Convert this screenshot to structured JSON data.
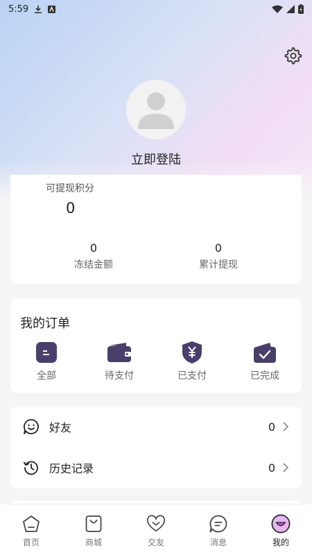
{
  "status_bar": {
    "time": "5:59"
  },
  "profile": {
    "login_label": "立即登陆"
  },
  "points": {
    "withdrawable_label": "可提现积分",
    "withdrawable_value": "0",
    "frozen_value": "0",
    "frozen_label": "冻结金额",
    "total_withdrawn_value": "0",
    "total_withdrawn_label": "累计提现"
  },
  "orders": {
    "title": "我的订单",
    "items": [
      {
        "label": "全部",
        "icon": "all-orders-icon"
      },
      {
        "label": "待支付",
        "icon": "wallet-icon"
      },
      {
        "label": "已支付",
        "icon": "yen-shield-icon"
      },
      {
        "label": "已完成",
        "icon": "check-wallet-icon"
      }
    ]
  },
  "list": [
    {
      "label": "好友",
      "count": "0",
      "icon": "smile-chat-icon"
    },
    {
      "label": "历史记录",
      "count": "0",
      "icon": "history-icon"
    }
  ],
  "tabs": [
    {
      "label": "首页",
      "icon": "home-icon"
    },
    {
      "label": "商城",
      "icon": "shopping-bag-icon"
    },
    {
      "label": "交友",
      "icon": "heart-icon"
    },
    {
      "label": "消息",
      "icon": "message-icon"
    },
    {
      "label": "我的",
      "icon": "profile-face-icon",
      "active": true
    }
  ],
  "colors": {
    "accent": "#4a3f6b",
    "active_tab": "#c24fd6"
  }
}
